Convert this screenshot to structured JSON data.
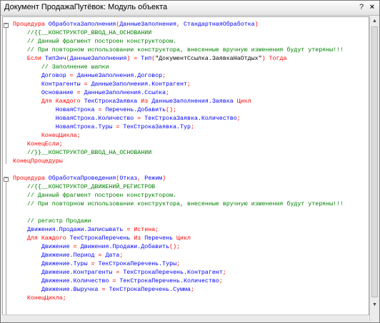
{
  "window": {
    "title": "Документ ПродажаПутёвок: Модуль объекта",
    "help_glyph": "?",
    "close_glyph": "×"
  },
  "code_lines": [
    [
      [
        "kw",
        "Процедура "
      ],
      [
        "id",
        "ОбработкаЗаполнения"
      ],
      [
        "kw",
        "("
      ],
      [
        "id",
        "ДанныеЗаполнения"
      ],
      [
        "kw",
        ", "
      ],
      [
        "id",
        "СтандартнаяОбработка"
      ],
      [
        "kw",
        ")"
      ]
    ],
    [
      [
        "cm",
        "    //{{__КОНСТРУКТОР_ВВОД_НА_ОСНОВАНИИ"
      ]
    ],
    [
      [
        "cm",
        "    // Данный фрагмент построен конструктором."
      ]
    ],
    [
      [
        "cm",
        "    // При повторном использовании конструктора, внесенные вручную изменения будут утеряны!!!"
      ]
    ],
    [
      [
        "kw",
        "    Если "
      ],
      [
        "id",
        "ТипЗнч"
      ],
      [
        "kw",
        "("
      ],
      [
        "id",
        "ДанныеЗаполнения"
      ],
      [
        "kw",
        ") = "
      ],
      [
        "id",
        "Тип"
      ],
      [
        "kw",
        "("
      ],
      [
        "st",
        "\"ДокументСсылка.ЗаявкаНаОтдых\""
      ],
      [
        "kw",
        ") "
      ],
      [
        "kw",
        "Тогда"
      ]
    ],
    [
      [
        "cm",
        "        // Заполнение шапки"
      ]
    ],
    [
      [
        "id",
        "        Договор "
      ],
      [
        "kw",
        "= "
      ],
      [
        "id",
        "ДанныеЗаполнения.Договор"
      ],
      [
        "kw",
        ";"
      ]
    ],
    [
      [
        "id",
        "        Контрагенты "
      ],
      [
        "kw",
        "= "
      ],
      [
        "id",
        "ДанныеЗаполнения.Контрагент"
      ],
      [
        "kw",
        ";"
      ]
    ],
    [
      [
        "id",
        "        Основание "
      ],
      [
        "kw",
        "= "
      ],
      [
        "id",
        "ДанныеЗаполнения.Ссылка"
      ],
      [
        "kw",
        ";"
      ]
    ],
    [
      [
        "kw",
        "        Для Каждого "
      ],
      [
        "id",
        "ТекСтрокаЗаявка "
      ],
      [
        "kw",
        "Из "
      ],
      [
        "id",
        "ДанныеЗаполнения.Заявка "
      ],
      [
        "kw",
        "Цикл"
      ]
    ],
    [
      [
        "id",
        "            НоваяСтрока "
      ],
      [
        "kw",
        "= "
      ],
      [
        "id",
        "Перечень.Добавить"
      ],
      [
        "kw",
        "();"
      ]
    ],
    [
      [
        "id",
        "            НоваяСтрока.Количество "
      ],
      [
        "kw",
        "= "
      ],
      [
        "id",
        "ТекСтрокаЗаявка.Количество"
      ],
      [
        "kw",
        ";"
      ]
    ],
    [
      [
        "id",
        "            НоваяСтрока.Туры "
      ],
      [
        "kw",
        "= "
      ],
      [
        "id",
        "ТекСтрокаЗаявка.Тур"
      ],
      [
        "kw",
        ";"
      ]
    ],
    [
      [
        "kw",
        "        КонецЦикла;"
      ]
    ],
    [
      [
        "kw",
        "    КонецЕсли;"
      ]
    ],
    [
      [
        "cm",
        "    //}}__КОНСТРУКТОР_ВВОД_НА_ОСНОВАНИИ"
      ]
    ],
    [
      [
        "kw",
        "КонецПроцедуры"
      ]
    ],
    [],
    [
      [
        "kw",
        "Процедура "
      ],
      [
        "id",
        "ОбработкаПроведения"
      ],
      [
        "kw",
        "("
      ],
      [
        "id",
        "Отказ"
      ],
      [
        "kw",
        ", "
      ],
      [
        "id",
        "Режим"
      ],
      [
        "kw",
        ")"
      ]
    ],
    [
      [
        "cm",
        "    //{{__КОНСТРУКТОР_ДВИЖЕНИЙ_РЕГИСТРОВ"
      ]
    ],
    [
      [
        "cm",
        "    // Данный фрагмент построен конструктором."
      ]
    ],
    [
      [
        "cm",
        "    // При повторном использовании конструктора, внесенные вручную изменения будут утеряны!!!"
      ]
    ],
    [],
    [
      [
        "cm",
        "    // регистр Продажи"
      ]
    ],
    [
      [
        "id",
        "    Движения.Продажи.Записывать "
      ],
      [
        "kw",
        "= "
      ],
      [
        "kw",
        "Истина"
      ],
      [
        "kw",
        ";"
      ]
    ],
    [
      [
        "kw",
        "    Для Каждого "
      ],
      [
        "id",
        "ТекСтрокаПеречень "
      ],
      [
        "kw",
        "Из "
      ],
      [
        "id",
        "Перечень "
      ],
      [
        "kw",
        "Цикл"
      ]
    ],
    [
      [
        "id",
        "        Движение "
      ],
      [
        "kw",
        "= "
      ],
      [
        "id",
        "Движения.Продажи.Добавить"
      ],
      [
        "kw",
        "();"
      ]
    ],
    [
      [
        "id",
        "        Движение.Период "
      ],
      [
        "kw",
        "= "
      ],
      [
        "id",
        "Дата"
      ],
      [
        "kw",
        ";"
      ]
    ],
    [
      [
        "id",
        "        Движение.Туры "
      ],
      [
        "kw",
        "= "
      ],
      [
        "id",
        "ТекСтрокаПеречень.Туры"
      ],
      [
        "kw",
        ";"
      ]
    ],
    [
      [
        "id",
        "        Движение.Контрагенты "
      ],
      [
        "kw",
        "= "
      ],
      [
        "id",
        "ТекСтрокаПеречень.Контрагент"
      ],
      [
        "kw",
        ";"
      ]
    ],
    [
      [
        "id",
        "        Движение.Количество "
      ],
      [
        "kw",
        "= "
      ],
      [
        "id",
        "ТекСтрокаПеречень.Количество"
      ],
      [
        "kw",
        ";"
      ]
    ],
    [
      [
        "id",
        "        Движение.Выручка "
      ],
      [
        "kw",
        "= "
      ],
      [
        "id",
        "ТекСтрокаПеречень.Сумма"
      ],
      [
        "kw",
        ";"
      ]
    ],
    [
      [
        "kw",
        "    КонецЦикла;"
      ]
    ]
  ],
  "fold_markers": [
    {
      "line": 0,
      "glyph": "−"
    },
    {
      "line": 18,
      "glyph": "−"
    }
  ],
  "scroll": {
    "up_glyph": "▲",
    "down_glyph": "▼"
  }
}
